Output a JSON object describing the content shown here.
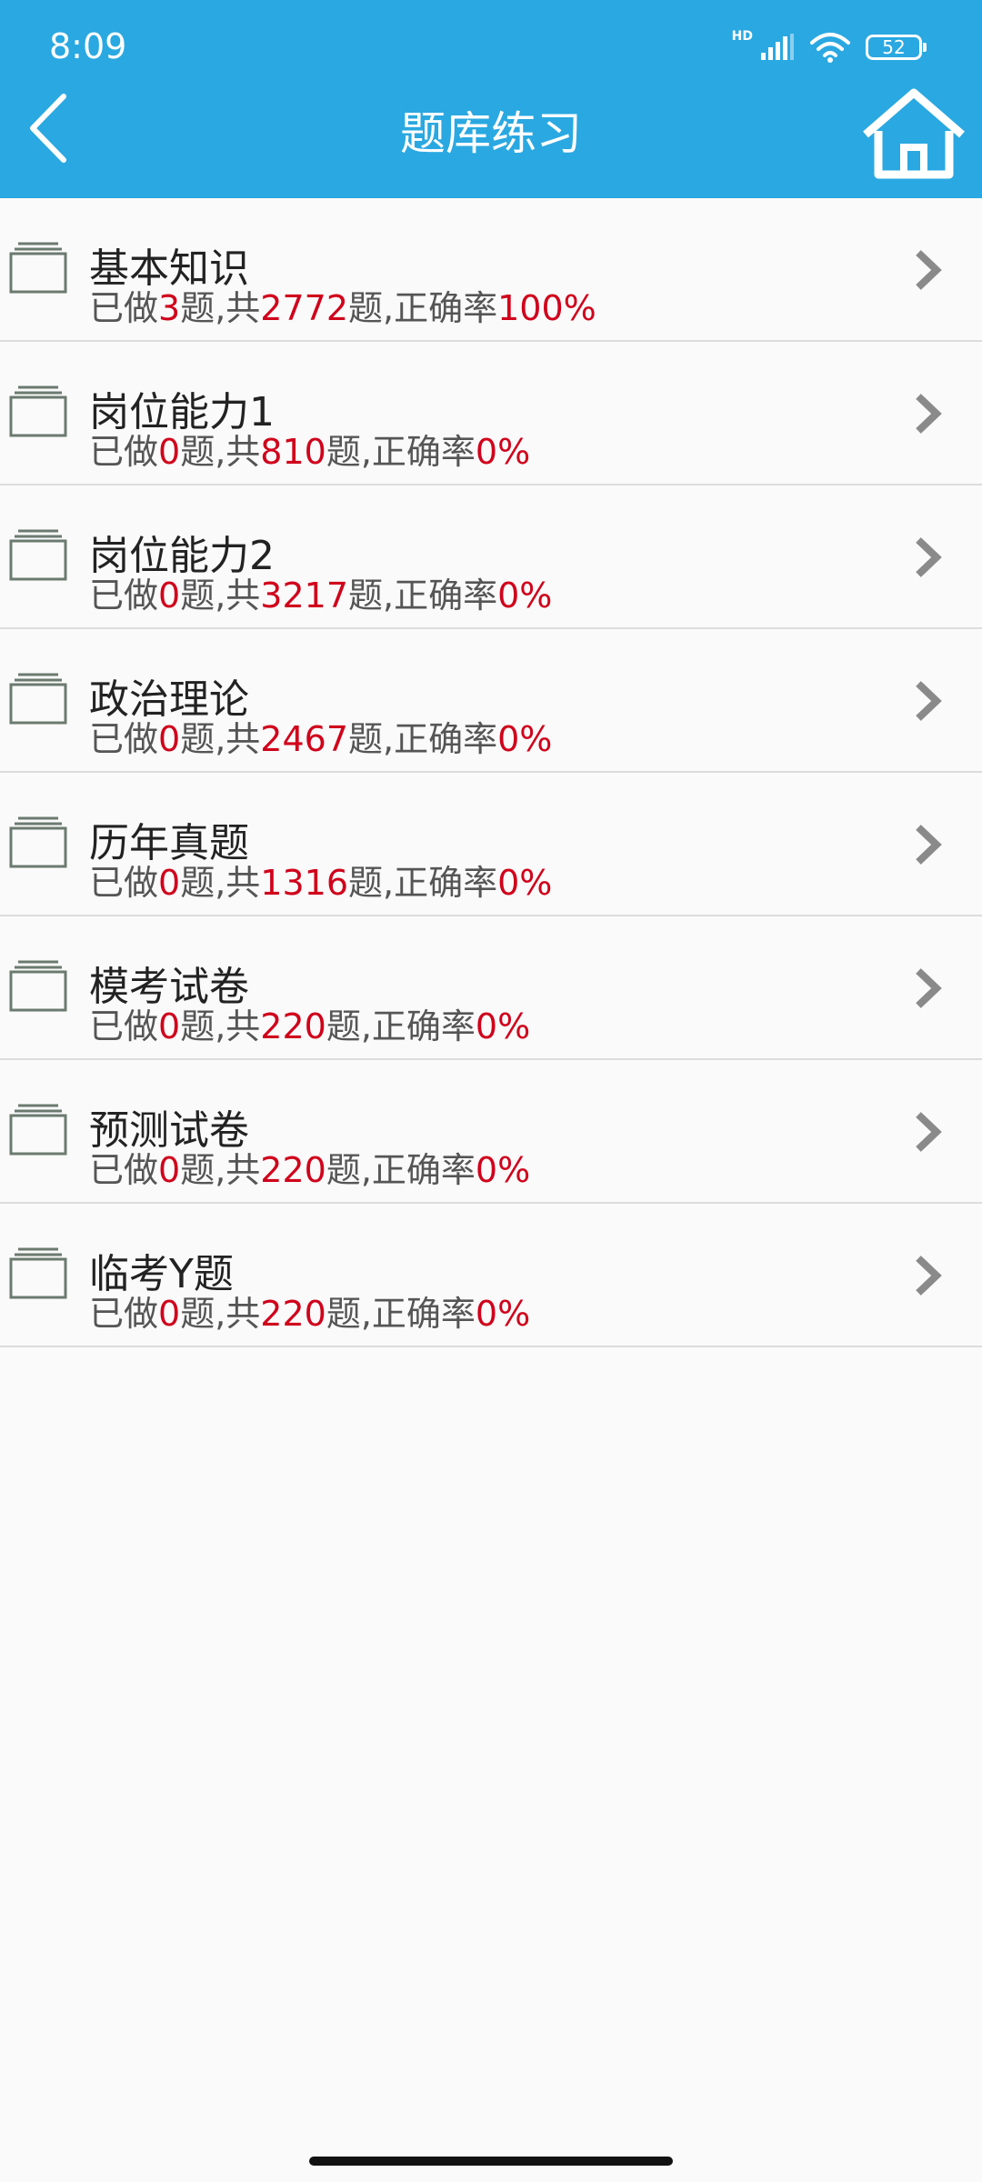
{
  "status_bar": {
    "time": "8:09",
    "network": "HD",
    "battery": "52"
  },
  "header": {
    "title": "题库练习"
  },
  "labels": {
    "done_prefix": "已做",
    "q_unit_total": "题,共",
    "q_unit_rate": "题,正确率"
  },
  "items": [
    {
      "title": "基本知识",
      "done": "3",
      "total": "2772",
      "rate": "100%"
    },
    {
      "title": "岗位能力1",
      "done": "0",
      "total": "810",
      "rate": "0%"
    },
    {
      "title": "岗位能力2",
      "done": "0",
      "total": "3217",
      "rate": "0%"
    },
    {
      "title": "政治理论",
      "done": "0",
      "total": "2467",
      "rate": "0%"
    },
    {
      "title": "历年真题",
      "done": "0",
      "total": "1316",
      "rate": "0%"
    },
    {
      "title": "模考试卷",
      "done": "0",
      "total": "220",
      "rate": "0%"
    },
    {
      "title": "预测试卷",
      "done": "0",
      "total": "220",
      "rate": "0%"
    },
    {
      "title": "临考Y题",
      "done": "0",
      "total": "220",
      "rate": "0%"
    }
  ],
  "colors": {
    "header_bg": "#2aa8e1",
    "highlight_red": "#d0021b",
    "icon_gray": "#6b7a6f"
  }
}
